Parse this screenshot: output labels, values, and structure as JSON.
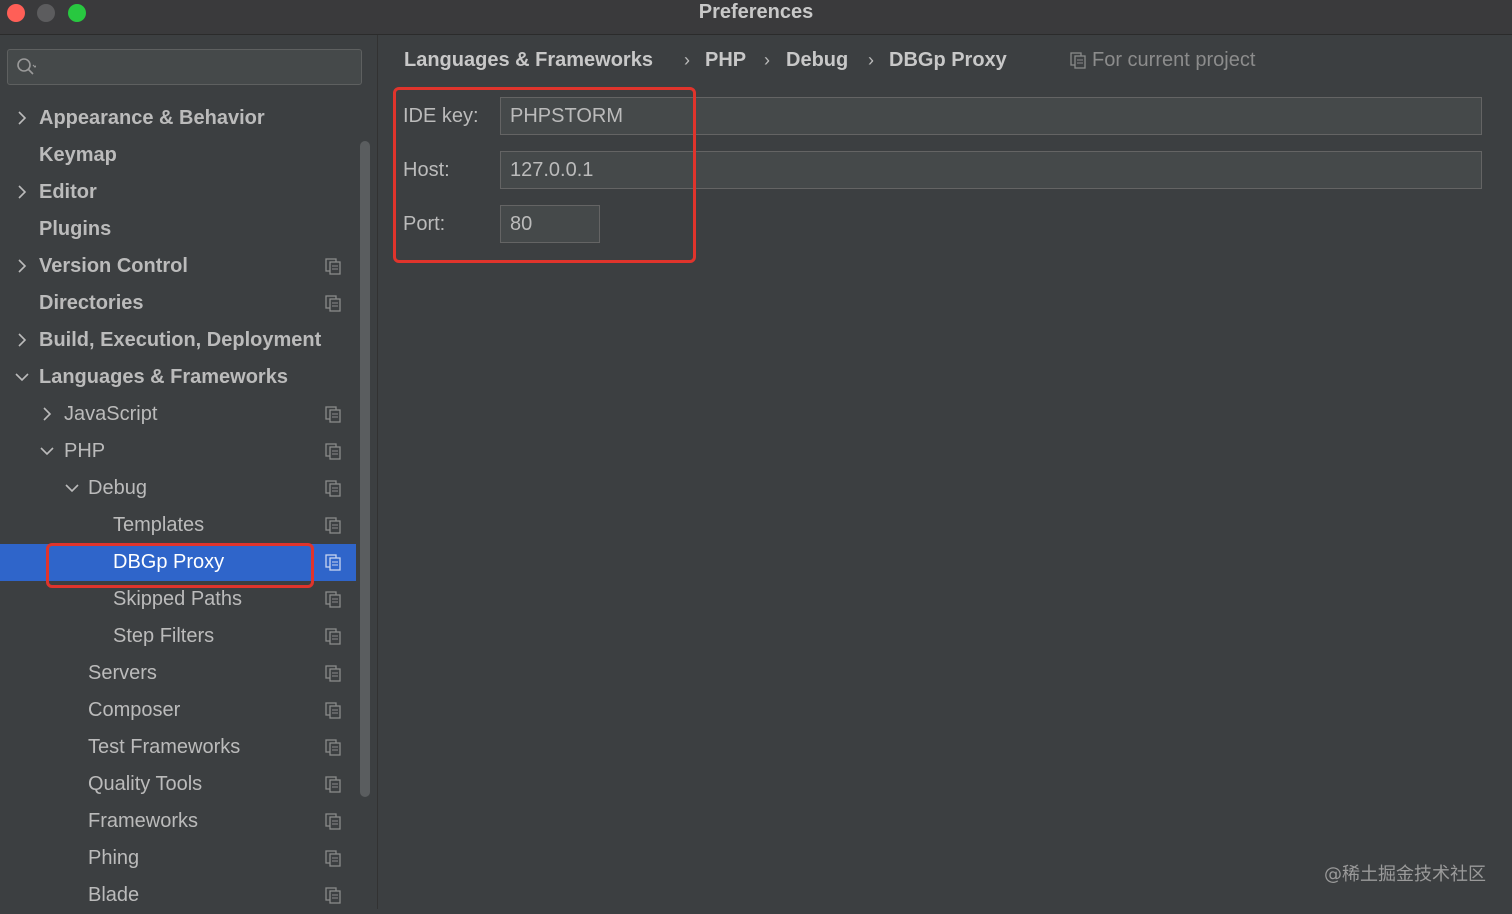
{
  "window": {
    "title": "Preferences"
  },
  "search": {
    "placeholder": ""
  },
  "sidebar": {
    "items": [
      {
        "label": "Appearance & Behavior"
      },
      {
        "label": "Keymap"
      },
      {
        "label": "Editor"
      },
      {
        "label": "Plugins"
      },
      {
        "label": "Version Control"
      },
      {
        "label": "Directories"
      },
      {
        "label": "Build, Execution, Deployment"
      },
      {
        "label": "Languages & Frameworks"
      },
      {
        "label": "JavaScript"
      },
      {
        "label": "PHP"
      },
      {
        "label": "Debug"
      },
      {
        "label": "Templates"
      },
      {
        "label": "DBGp Proxy"
      },
      {
        "label": "Skipped Paths"
      },
      {
        "label": "Step Filters"
      },
      {
        "label": "Servers"
      },
      {
        "label": "Composer"
      },
      {
        "label": "Test Frameworks"
      },
      {
        "label": "Quality Tools"
      },
      {
        "label": "Frameworks"
      },
      {
        "label": "Phing"
      },
      {
        "label": "Blade"
      }
    ]
  },
  "breadcrumb": {
    "items": [
      "Languages & Frameworks",
      "PHP",
      "Debug",
      "DBGp Proxy"
    ],
    "separator": "›",
    "scope_label": "For current project"
  },
  "form": {
    "ide_key": {
      "label": "IDE key:",
      "value": "PHPSTORM"
    },
    "host": {
      "label": "Host:",
      "value": "127.0.0.1"
    },
    "port": {
      "label": "Port:",
      "value": "80"
    }
  },
  "watermark": "@稀土掘金技术社区",
  "colors": {
    "selection": "#2f65ca",
    "highlight": "#e0342c",
    "background": "#3c3f41"
  }
}
